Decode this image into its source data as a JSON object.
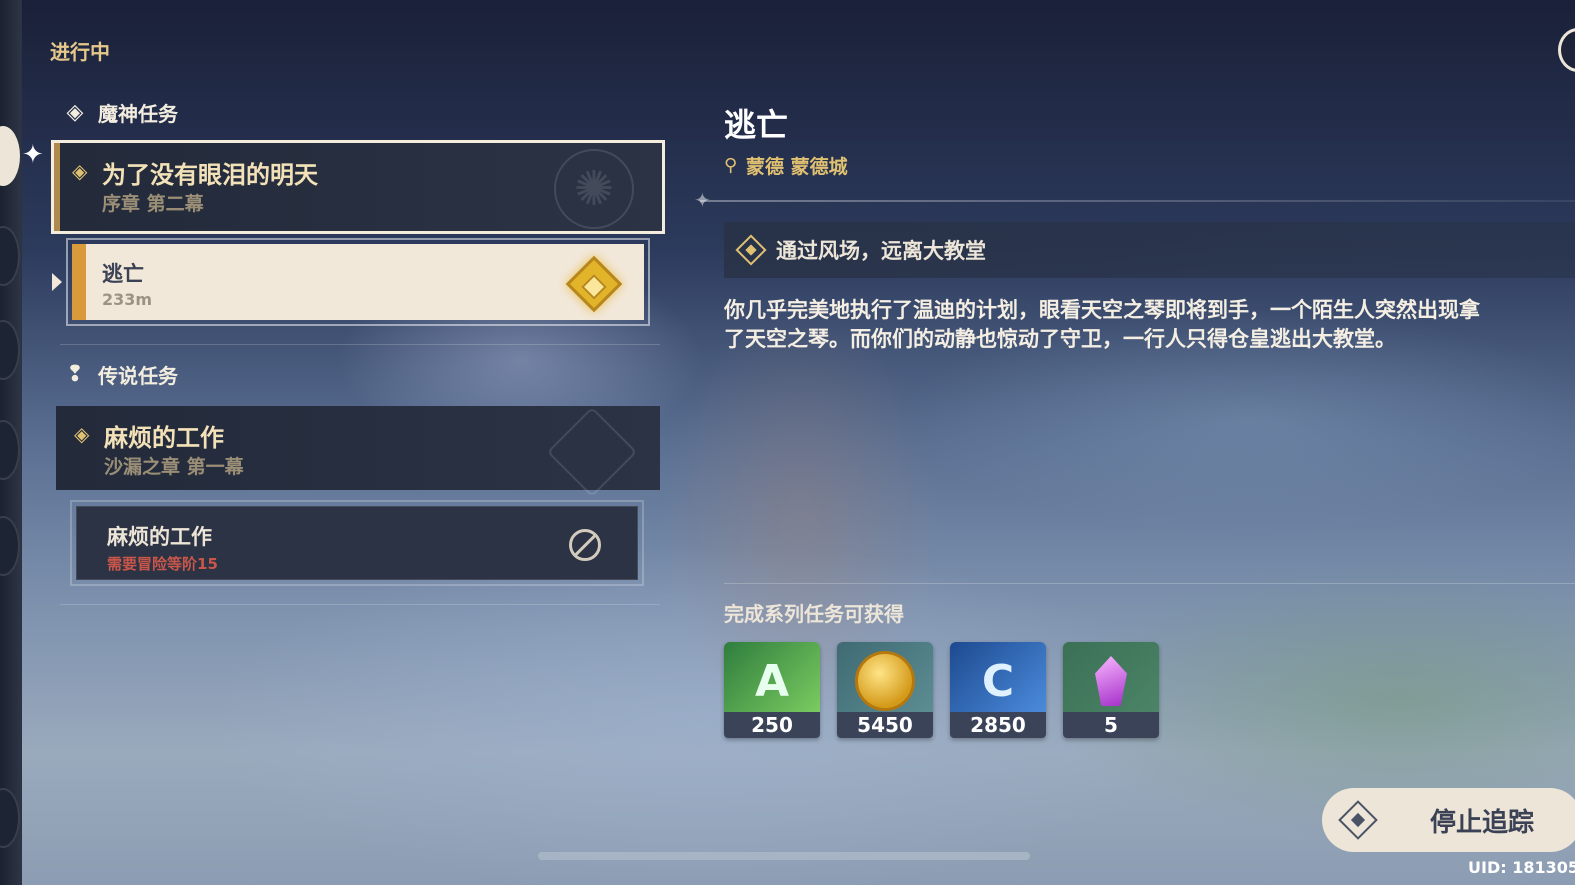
{
  "header": {
    "status": "进行中"
  },
  "sections": {
    "archon": {
      "label": "魔神任务"
    },
    "legend": {
      "label": "传说任务"
    }
  },
  "quests": {
    "archon_main": {
      "title": "为了没有眼泪的明天",
      "subtitle": "序章 第二幕"
    },
    "archon_sub": {
      "title": "逃亡",
      "distance": "233m"
    },
    "legend_main": {
      "title": "麻烦的工作",
      "subtitle": "沙漏之章 第一幕"
    },
    "legend_sub": {
      "title": "麻烦的工作",
      "requirement": "需要冒险等阶15"
    }
  },
  "detail": {
    "title": "逃亡",
    "location": "蒙德 蒙德城",
    "objective": "通过风场，远离大教堂",
    "description_line1": "你几乎完美地执行了温迪的计划，眼看天空之琴即将到手，一个陌生人突然出现拿",
    "description_line2": "了天空之琴。而你们的动静也惊动了守卫，一行人只得仓皇逃出大教堂。",
    "rewards_title": "完成系列任务可获得",
    "rewards": [
      {
        "icon": "adventure-exp-icon",
        "count": "250"
      },
      {
        "icon": "mora-coin-icon",
        "count": "5450"
      },
      {
        "icon": "companionship-exp-icon",
        "count": "2850"
      },
      {
        "icon": "primogem-icon",
        "count": "5"
      }
    ]
  },
  "actions": {
    "stop_tracking": "停止追踪"
  },
  "footer": {
    "uid": "UID: 181305"
  },
  "colors": {
    "accent_gold": "#e0c071",
    "panel_cream": "#ece5d8",
    "locked_red": "#c9564a"
  }
}
